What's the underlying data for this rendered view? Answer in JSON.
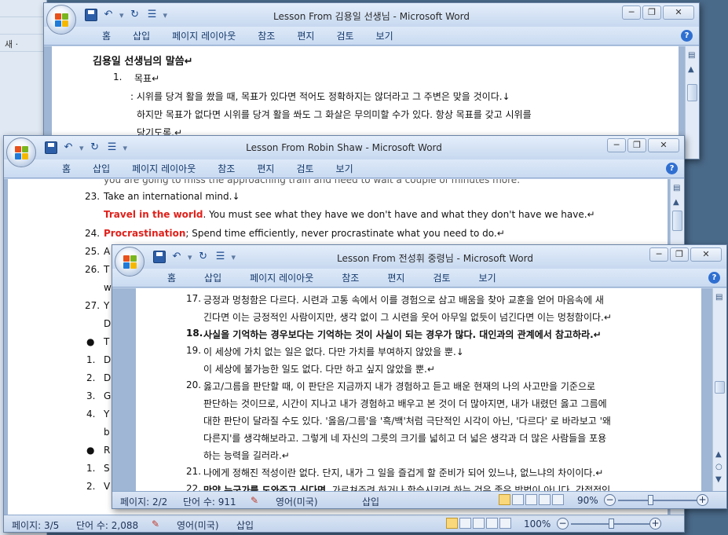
{
  "background_strip": {
    "items": [
      "새 ·"
    ]
  },
  "win1": {
    "title": "Lesson From 김용일 선생님 - Microsoft Word",
    "tabs": [
      "홈",
      "삽입",
      "페이지 레이아웃",
      "참조",
      "편지",
      "검토",
      "보기"
    ],
    "content": {
      "heading": "김용일 선생님의 말씀↵",
      "item1_num": "1.",
      "item1_title": "목표↵",
      "line1": ": 시위를 당겨 활을 쐈을 때, 목표가 있다면 적어도 정확하지는 않더라고 그 주변은 맞을 것이다.↓",
      "line2": "하지만 목표가 없다면 시위를 당겨 활을 쏴도 그 화살은 무의미할 수가 있다. 항상 목표를 갖고 시위를",
      "line3": "당기도록.↵"
    }
  },
  "win2": {
    "title": "Lesson From Robin Shaw - Microsoft Word",
    "tabs": [
      "홈",
      "삽입",
      "페이지 레이아웃",
      "참조",
      "편지",
      "검토",
      "보기"
    ],
    "content": {
      "top_partial": "you are going to miss the approaching train and need to wait a couple of minutes more.",
      "n23": "23.",
      "l23": "Take an international mind.↓",
      "l23b_red": "Travel in the world",
      "l23b_rest": ". You must see what they have we don't have and what they don't have we have.↵",
      "n24": "24.",
      "l24_red": "Procrastination",
      "l24_rest": "; Spend time efficiently,  never procrastinate what you need to do.↵",
      "n25": "25.",
      "l25": "A",
      "n26": "26.",
      "l26": "T",
      "l26b": "w",
      "n27": "27.",
      "l27": "Y",
      "l27b": "D",
      "bullet1": "●",
      "b1": "T",
      "s1n": "1.",
      "s1": "D",
      "s2n": "2.",
      "s2": "D",
      "s3n": "3.",
      "s3": "G",
      "s4n": "4.",
      "s4": "Y",
      "s4b": "b",
      "bullet2": "●",
      "b2": "R",
      "t1n": "1.",
      "t1": "S",
      "t2n": "2.",
      "t2": "V"
    },
    "status": {
      "page": "페이지: 3/5",
      "words": "단어 수: 2,088",
      "lang": "영어(미국)",
      "mode": "삽입",
      "zoom": "100%"
    }
  },
  "win3": {
    "title": "Lesson From 전성휘 중령님 - Microsoft Word",
    "tabs": [
      "홈",
      "삽입",
      "페이지 레이아웃",
      "참조",
      "편지",
      "검토",
      "보기"
    ],
    "content": {
      "n17": "17.",
      "l17a": "긍정과 멍청함은 다르다. 시련과 고통 속에서 이를 경험으로 삼고 배움을 찾아 교훈을 얻어 마음속에 새",
      "l17b": "긴다면 이는 긍정적인 사람이지만, 생각 없이 그 시련을 웃어 아무일 없듯이 넘긴다면 이는 멍청함이다.↵",
      "n18": "18.",
      "l18": "사실을 기억하는 경우보다는 기억하는 것이 사실이 되는 경우가 많다. 대인과의 관계에서 참고하라.↵",
      "n19": "19.",
      "l19a": "이 세상에 가치 없는 일은 없다. 다만 가치를 부여하지 않았을 뿐.↓",
      "l19b": "이 세상에 불가능한 일도 없다. 다만 하고 싶지 않았을 뿐.↵",
      "n20": "20.",
      "l20a": "옳고/그름을 판단할 때, 이 판단은 지금까지 내가 경험하고 듣고 배운 현재의 나의 사고만을 기준으로",
      "l20b": "판단하는 것이므로, 시간이 지나고 내가 경험하고 배우고 본 것이 더 많아지면, 내가 내렸던 옳고 그름에",
      "l20c": "대한 판단이 달라질 수도 있다. '옳음/그름'을 '흑/백'처럼 극단적인 시각이 아닌, '다르다' 로 바라보고 '왜",
      "l20d": "다른지'를 생각해보라고. 그렇게 네 자신의 그릇의 크기를 넓히고 더 넓은 생각과 더 많은 사람들을 포용",
      "l20e": "하는 능력을 길러라.↵",
      "n21": "21.",
      "l21": "나에게 정해진 적성이란 없다. 단지, 내가 그 일을 즐겁게 할 준비가 되어 있느냐, 없느냐의 차이이다.↵",
      "n22": "22.",
      "l22_bold": "만약 누군가를 도와주고 싶다면",
      "l22_rest": ", 가르쳐주려 하거나 학습시키려 하는 것은 좋은 방법이 아니다. 간접적인"
    },
    "status": {
      "page": "페이지: 2/2",
      "words": "단어 수: 911",
      "lang": "영어(미국)",
      "mode": "삽입",
      "zoom": "90%"
    }
  }
}
